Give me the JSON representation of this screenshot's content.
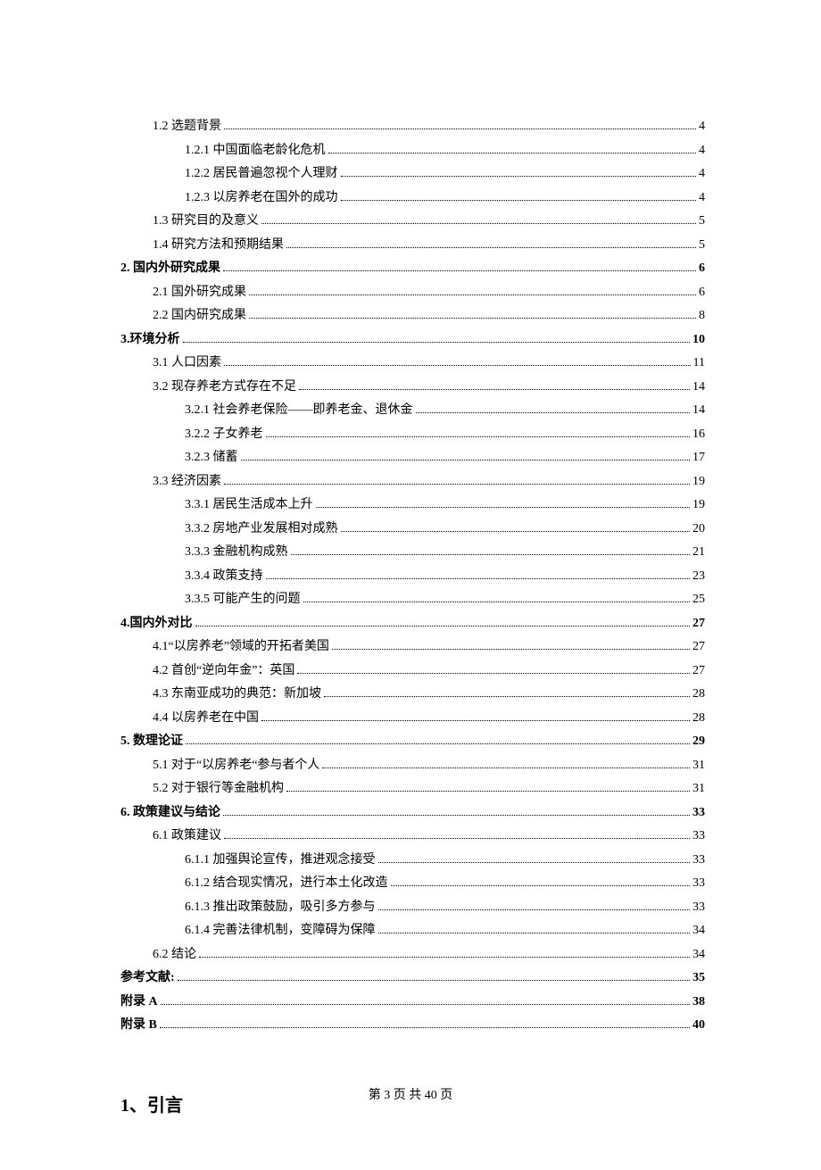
{
  "toc": [
    {
      "label": "1.2 选题背景",
      "page": "4",
      "indent": 1,
      "bold": false
    },
    {
      "label": "1.2.1 中国面临老龄化危机",
      "page": "4",
      "indent": 2,
      "bold": false
    },
    {
      "label": "1.2.2 居民普遍忽视个人理财",
      "page": "4",
      "indent": 2,
      "bold": false
    },
    {
      "label": "1.2.3 以房养老在国外的成功",
      "page": "4",
      "indent": 2,
      "bold": false
    },
    {
      "label": "1.3 研究目的及意义",
      "page": "5",
      "indent": 1,
      "bold": false
    },
    {
      "label": "1.4 研究方法和预期结果",
      "page": "5",
      "indent": 1,
      "bold": false
    },
    {
      "label": "2.  国内外研究成果",
      "page": "6",
      "indent": 0,
      "bold": true
    },
    {
      "label": "2.1 国外研究成果",
      "page": "6",
      "indent": 1,
      "bold": false
    },
    {
      "label": "2.2  国内研究成果",
      "page": "8",
      "indent": 1,
      "bold": false
    },
    {
      "label": "3.环境分析",
      "page": "10",
      "indent": 0,
      "bold": true
    },
    {
      "label": "3.1 人口因素",
      "page": "11",
      "indent": 1,
      "bold": false
    },
    {
      "label": "3.2 现存养老方式存在不足",
      "page": "14",
      "indent": 1,
      "bold": false
    },
    {
      "label": "3.2.1 社会养老保险——即养老金、退休金",
      "page": "14",
      "indent": 2,
      "bold": false
    },
    {
      "label": "3.2.2 子女养老",
      "page": "16",
      "indent": 2,
      "bold": false
    },
    {
      "label": "3.2.3 储蓄",
      "page": "17",
      "indent": 2,
      "bold": false
    },
    {
      "label": "3.3 经济因素",
      "page": "19",
      "indent": 1,
      "bold": false
    },
    {
      "label": "3.3.1 居民生活成本上升",
      "page": "19",
      "indent": 2,
      "bold": false
    },
    {
      "label": "3.3.2 房地产业发展相对成熟",
      "page": "20",
      "indent": 2,
      "bold": false
    },
    {
      "label": "3.3.3 金融机构成熟",
      "page": "21",
      "indent": 2,
      "bold": false
    },
    {
      "label": "3.3.4 政策支持",
      "page": "23",
      "indent": 2,
      "bold": false
    },
    {
      "label": "3.3.5 可能产生的问题",
      "page": "25",
      "indent": 2,
      "bold": false
    },
    {
      "label": "4.国内外对比",
      "page": "27",
      "indent": 0,
      "bold": true
    },
    {
      "label": "4.1“以房养老”领域的开拓者美国",
      "page": "27",
      "indent": 1,
      "bold": false
    },
    {
      "label": "4.2 首创“逆向年金”：英国",
      "page": "27",
      "indent": 1,
      "bold": false
    },
    {
      "label": "4.3 东南亚成功的典范：新加坡",
      "page": "28",
      "indent": 1,
      "bold": false
    },
    {
      "label": "4.4 以房养老在中国",
      "page": "28",
      "indent": 1,
      "bold": false
    },
    {
      "label": "5.  数理论证",
      "page": "29",
      "indent": 0,
      "bold": true
    },
    {
      "label": "5.1 对于“以房养老“参与者个人",
      "page": "31",
      "indent": 1,
      "bold": false
    },
    {
      "label": "5.2 对于银行等金融机构",
      "page": "31",
      "indent": 1,
      "bold": false
    },
    {
      "label": "6.  政策建议与结论",
      "page": "33",
      "indent": 0,
      "bold": true
    },
    {
      "label": "6.1 政策建议",
      "page": "33",
      "indent": 1,
      "bold": false
    },
    {
      "label": "6.1.1 加强舆论宣传，推进观念接受",
      "page": "33",
      "indent": 2,
      "bold": false
    },
    {
      "label": "6.1.2 结合现实情况，进行本土化改造",
      "page": "33",
      "indent": 2,
      "bold": false
    },
    {
      "label": "6.1.3 推出政策鼓励，吸引多方参与",
      "page": "33",
      "indent": 2,
      "bold": false
    },
    {
      "label": "6.1.4 完善法律机制，变障碍为保障",
      "page": "34",
      "indent": 2,
      "bold": false
    },
    {
      "label": "6.2 结论",
      "page": "34",
      "indent": 1,
      "bold": false
    },
    {
      "label": "参考文献:",
      "page": "35",
      "indent": 0,
      "bold": true
    },
    {
      "label": "附录 A",
      "page": "38",
      "indent": 0,
      "bold": true
    },
    {
      "label": "附录 B",
      "page": "40",
      "indent": 0,
      "bold": true
    }
  ],
  "heading": "1、引言",
  "footer": "第 3 页 共 40 页"
}
